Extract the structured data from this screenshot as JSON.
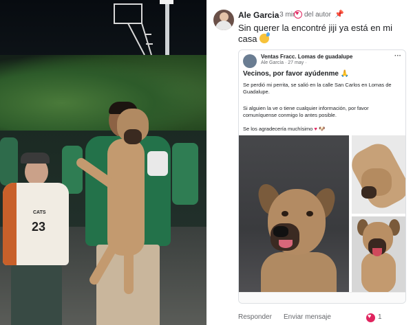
{
  "post": {
    "author": "Ale Garcia",
    "time": "· 3 min",
    "badge_label": "del autor",
    "caption": "Sin querer la encontré jiji ya está en mi casa"
  },
  "shared_post": {
    "group": "Ventas Fracc. Lomas de guadalupe",
    "sub": "Ale García · 27 may ·",
    "title": "Vecinos, por favor ayúdenme 🙏",
    "paragraph1": "Se perdió mi perrita, se salió en la calle San Carlos en Lomas de Guadalupe.",
    "paragraph2": "Si alguien la ve o tiene cualquier información, por favor comuníquense conmigo lo antes posible.",
    "paragraph3": "Se los agradecería muchísimo",
    "menu": "···"
  },
  "photo": {
    "shirt_text": "CATS",
    "shirt_number": "23"
  },
  "actions": {
    "reply": "Responder",
    "send_message": "Enviar mensaje",
    "reaction_count": "1"
  },
  "colors": {
    "accent": "#e0245e",
    "meta": "#65676b"
  }
}
